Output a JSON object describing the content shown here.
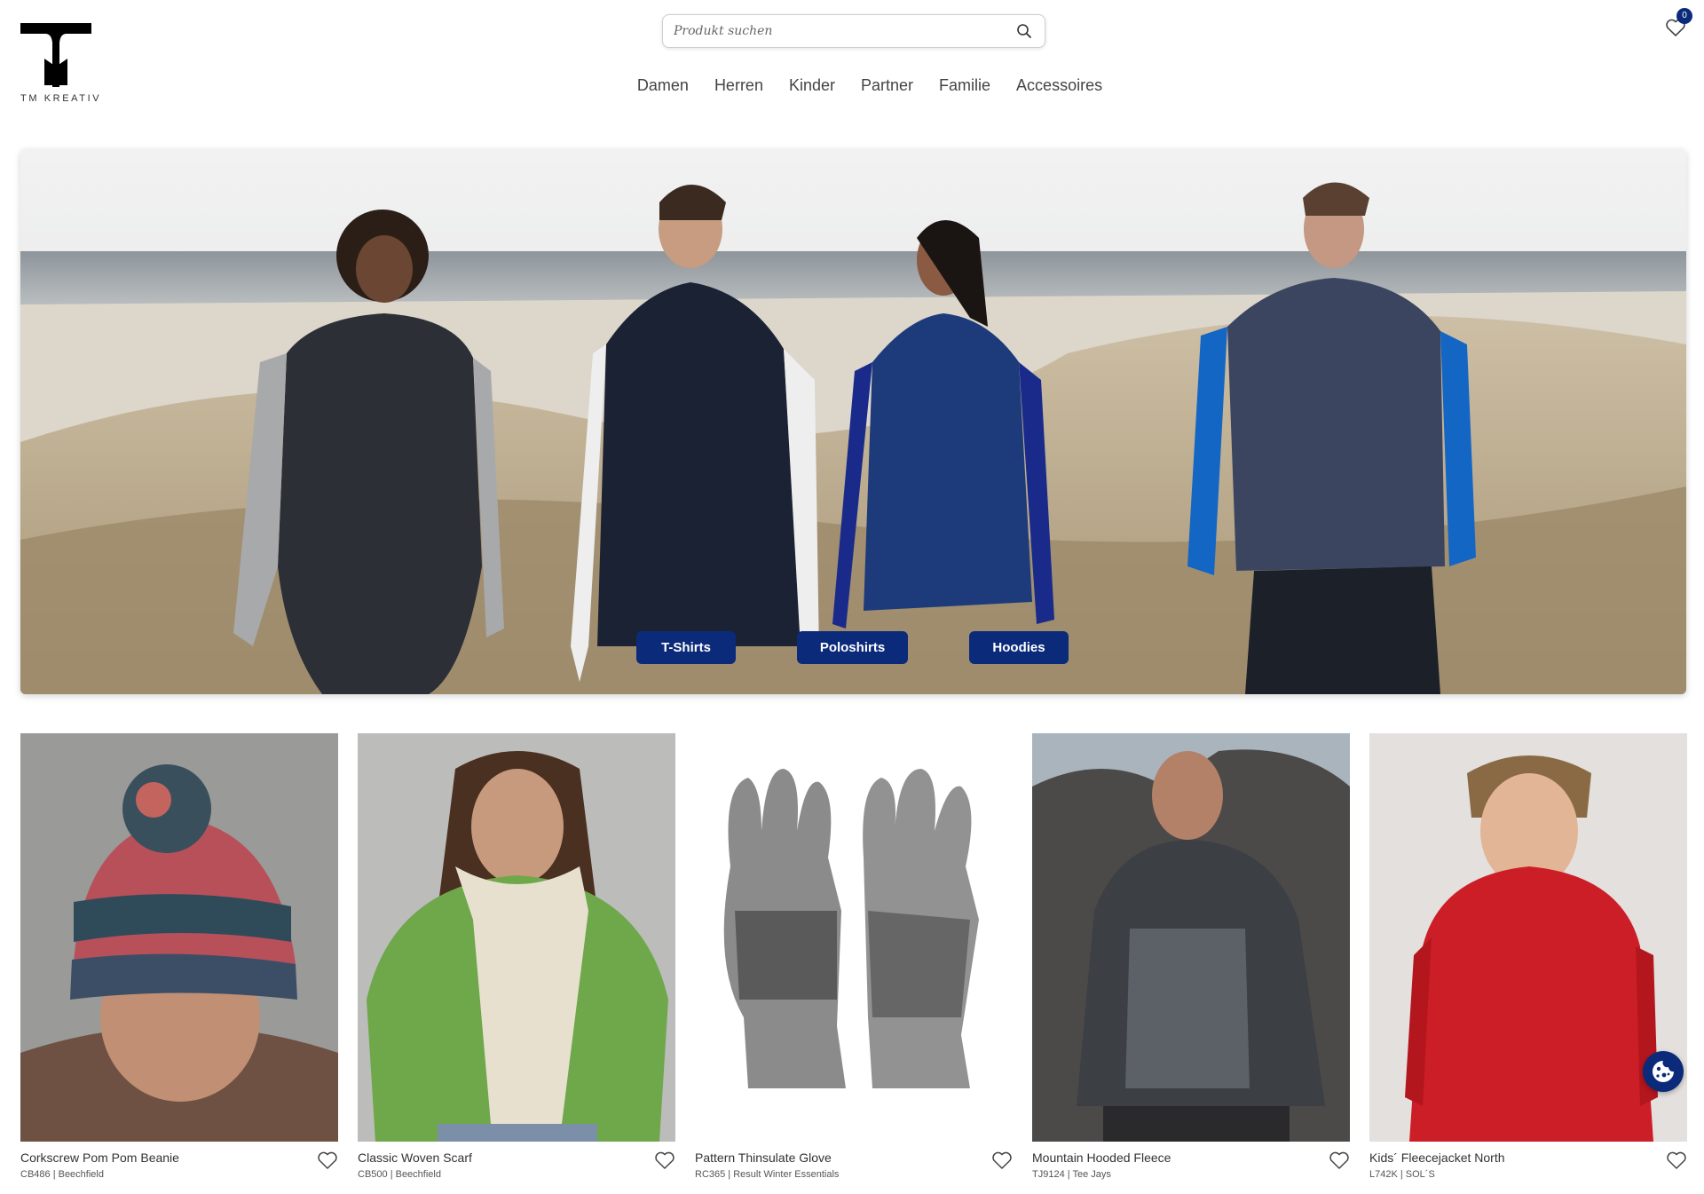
{
  "brand": {
    "name": "TM KREATIV"
  },
  "search": {
    "placeholder": "Produkt suchen"
  },
  "wishlist": {
    "count": "0"
  },
  "nav": {
    "items": [
      {
        "label": "Damen"
      },
      {
        "label": "Herren"
      },
      {
        "label": "Kinder"
      },
      {
        "label": "Partner"
      },
      {
        "label": "Familie"
      },
      {
        "label": "Accessoires"
      }
    ]
  },
  "hero": {
    "buttons": [
      {
        "label": "T-Shirts"
      },
      {
        "label": "Poloshirts"
      },
      {
        "label": "Hoodies"
      }
    ]
  },
  "products": [
    {
      "title": "Corkscrew Pom Pom Beanie",
      "sub": "CB486 | Beechfield"
    },
    {
      "title": "Classic Woven Scarf",
      "sub": "CB500 | Beechfield"
    },
    {
      "title": "Pattern Thinsulate Glove",
      "sub": "RC365 | Result Winter Essentials"
    },
    {
      "title": "Mountain Hooded Fleece",
      "sub": "TJ9124 | Tee Jays"
    },
    {
      "title": "Kids´ Fleecejacket North",
      "sub": "L742K | SOL´S"
    }
  ],
  "colors": {
    "accent": "#0b2a7a"
  },
  "icons": [
    "search-icon",
    "heart-icon",
    "cookie-icon"
  ]
}
